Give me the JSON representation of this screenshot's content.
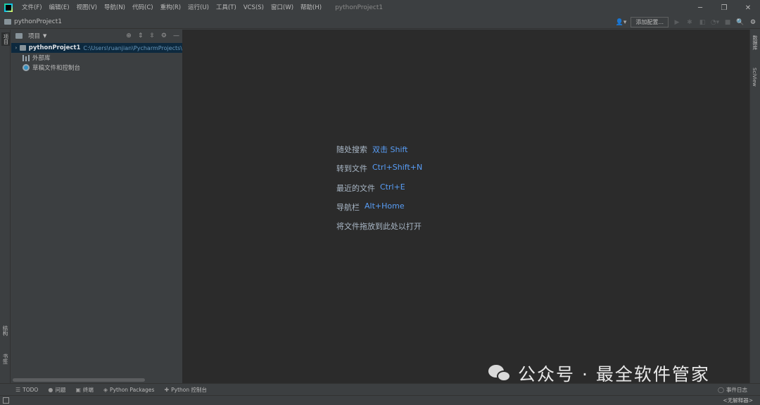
{
  "menu": {
    "items": [
      "文件(F)",
      "编辑(E)",
      "视图(V)",
      "导航(N)",
      "代码(C)",
      "重构(R)",
      "运行(U)",
      "工具(T)",
      "VCS(S)",
      "窗口(W)",
      "帮助(H)"
    ],
    "window_title": "pythonProject1"
  },
  "window_controls": {
    "minimize": "─",
    "restore": "❐",
    "close": "✕"
  },
  "navbar": {
    "breadcrumb": "pythonProject1",
    "user_icon": "user-icon",
    "add_config": "添加配置..."
  },
  "left_stripe": {
    "project": "项目",
    "structure": "结构",
    "bookmarks": "书签"
  },
  "project_panel": {
    "title": "项目",
    "tree": {
      "root_name": "pythonProject1",
      "root_path": "C:\\Users\\ruanjian\\PycharmProjects\\",
      "external_libs": "外部库",
      "scratches": "草稿文件和控制台"
    }
  },
  "editor": {
    "hints": [
      {
        "label": "随处搜索",
        "key": "双击 Shift"
      },
      {
        "label": "转到文件",
        "key": "Ctrl+Shift+N"
      },
      {
        "label": "最近的文件",
        "key": "Ctrl+E"
      },
      {
        "label": "导航栏",
        "key": "Alt+Home"
      }
    ],
    "drop_text": "将文件拖放到此处以打开"
  },
  "right_stripe": {
    "database": "数据库",
    "sciview": "SciView"
  },
  "bottom_bar": {
    "tabs": [
      {
        "label": "TODO",
        "icon": "list-icon"
      },
      {
        "label": "问题",
        "icon": "info-icon"
      },
      {
        "label": "终端",
        "icon": "terminal-icon"
      },
      {
        "label": "Python Packages",
        "icon": "layers-icon"
      },
      {
        "label": "Python 控制台",
        "icon": "python-icon"
      }
    ],
    "event_log": "事件日志"
  },
  "status_bar": {
    "interpreter": "<无解释器>"
  },
  "watermark": {
    "text": "公众号 · 最全软件管家"
  },
  "colors": {
    "editor_bg": "#2b2b2b",
    "panel_bg": "#3c3f41",
    "hint_key": "#589df6",
    "selection": "#0d293e"
  }
}
